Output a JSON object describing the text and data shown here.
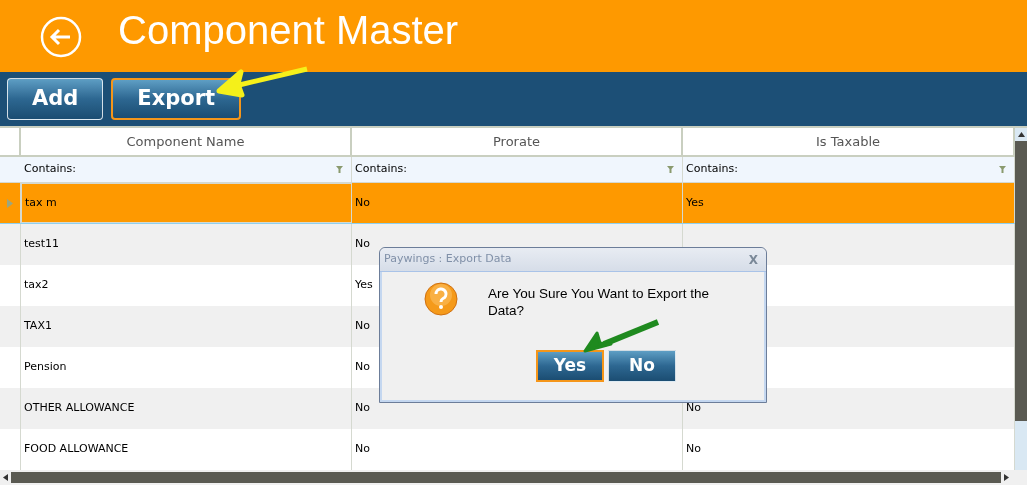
{
  "header": {
    "title": "Component Master"
  },
  "toolbar": {
    "buttons": [
      {
        "label": "Add",
        "focused": false
      },
      {
        "label": "Export",
        "focused": true
      }
    ]
  },
  "table": {
    "columns": [
      "Component Name",
      "Prorate",
      "Is Taxable"
    ],
    "filters": [
      "Contains:",
      "Contains:",
      "Contains:"
    ],
    "rows": [
      {
        "cells": [
          "tax m",
          "No",
          "Yes"
        ],
        "selected": true
      },
      {
        "cells": [
          "test11",
          "No",
          null
        ],
        "selected": false
      },
      {
        "cells": [
          "tax2",
          "Yes",
          null
        ],
        "selected": false
      },
      {
        "cells": [
          "TAX1",
          "No",
          null
        ],
        "selected": false
      },
      {
        "cells": [
          "Pension",
          "No",
          null
        ],
        "selected": false
      },
      {
        "cells": [
          "OTHER ALLOWANCE",
          "No",
          "No"
        ],
        "selected": false
      },
      {
        "cells": [
          "FOOD ALLOWANCE",
          "No",
          "No"
        ],
        "selected": false
      }
    ]
  },
  "dialog": {
    "title": "Paywings : Export Data",
    "close": "X",
    "message": "Are You Sure You Want to Export the Data?",
    "buttons": [
      {
        "label": "Yes",
        "focused": true
      },
      {
        "label": "No",
        "focused": false
      }
    ]
  }
}
